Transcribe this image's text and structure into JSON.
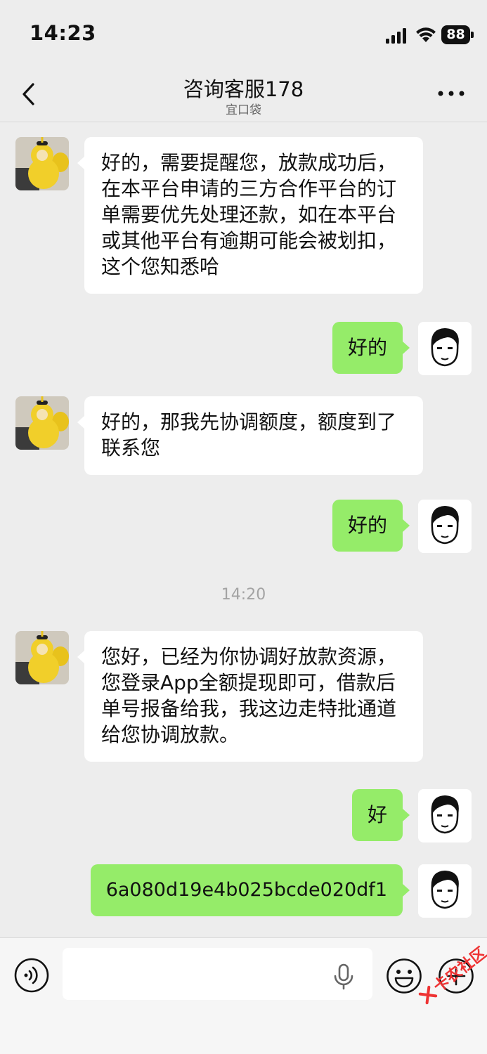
{
  "status_bar": {
    "time": "14:23",
    "battery": "88"
  },
  "nav": {
    "title": "咨询客服178",
    "subtitle": "宜口袋"
  },
  "messages": [
    {
      "side": "in",
      "text": "好的，需要提醒您，放款成功后，在本平台申请的三方合作平台的订单需要优先处理还款，如在本平台或其他平台有逾期可能会被划扣，这个您知悉哈"
    },
    {
      "side": "out",
      "text": "好的"
    },
    {
      "side": "in",
      "text": "好的，那我先协调额度，额度到了联系您"
    },
    {
      "side": "out",
      "text": "好的"
    },
    {
      "side": "in",
      "text": "您好，已经为你协调好放款资源，您登录App全额提现即可，借款后单号报备给我，我这边走特批通道给您协调放款。"
    },
    {
      "side": "out",
      "text": "好"
    },
    {
      "side": "out",
      "text": "6a080d19e4b025bcde020df1"
    }
  ],
  "timestamp": "14:20",
  "input": {
    "placeholder": ""
  },
  "watermark": "卡农社区",
  "colors": {
    "background": "#ededed",
    "bubble_out": "#95ec69",
    "bubble_in": "#ffffff",
    "watermark": "#e33333"
  },
  "icons": {
    "back": "chevron-left-icon",
    "more": "more-dots-icon",
    "voice": "voice-icon",
    "mic": "mic-icon",
    "emoji": "emoji-icon",
    "plus": "plus-icon"
  }
}
